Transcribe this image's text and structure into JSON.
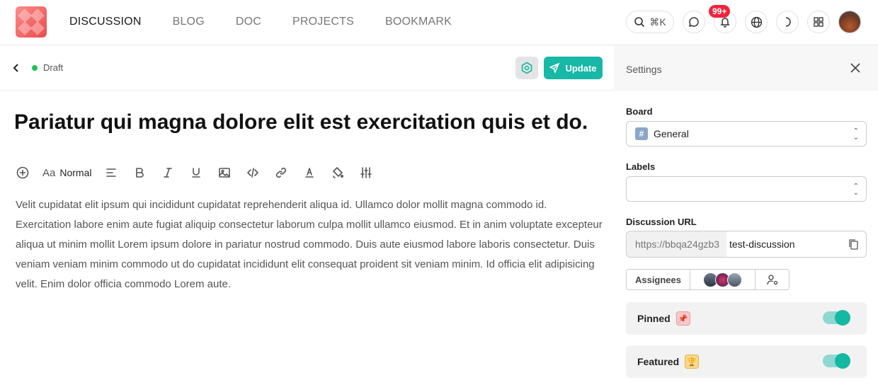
{
  "nav": {
    "items": [
      {
        "label": "DISCUSSION",
        "active": true
      },
      {
        "label": "BLOG",
        "active": false
      },
      {
        "label": "DOC",
        "active": false
      },
      {
        "label": "PROJECTS",
        "active": false
      },
      {
        "label": "BOOKMARK",
        "active": false
      }
    ]
  },
  "topbar": {
    "search_shortcut": "⌘K",
    "notification_count": "99+",
    "icons": [
      "search-icon",
      "chat-icon",
      "bell-icon",
      "globe-icon",
      "moon-icon",
      "apps-icon",
      "avatar"
    ]
  },
  "editor": {
    "status": "Draft",
    "update_label": "Update",
    "title": "Pariatur qui magna dolore elit est exercitation quis et do.",
    "text_style": "Normal",
    "body": "Velit cupidatat elit ipsum qui incididunt cupidatat reprehenderit aliqua id. Ullamco dolor mollit magna commodo id. Exercitation labore enim aute fugiat aliquip consectetur laborum culpa mollit ullamco eiusmod. Et in anim voluptate excepteur aliqua ut minim mollit Lorem ipsum dolore in pariatur nostrud commodo. Duis aute eiusmod labore laboris consectetur. Duis veniam veniam minim commodo ut do cupidatat incididunt elit consequat proident sit veniam minim. Id officia elit adipisicing velit. Enim dolor officia commodo Lorem aute."
  },
  "settings": {
    "title": "Settings",
    "board_label": "Board",
    "board_value": "General",
    "labels_label": "Labels",
    "labels_value": "",
    "url_label": "Discussion URL",
    "url_prefix": "https://bbqa24gzb3",
    "url_value": "test-discussion",
    "assignees_label": "Assignees",
    "pinned_label": "Pinned",
    "pinned_on": true,
    "featured_label": "Featured",
    "featured_on": true
  },
  "colors": {
    "accent": "#17b8a6",
    "badge": "#f0233b",
    "status_dot": "#20c05c"
  }
}
